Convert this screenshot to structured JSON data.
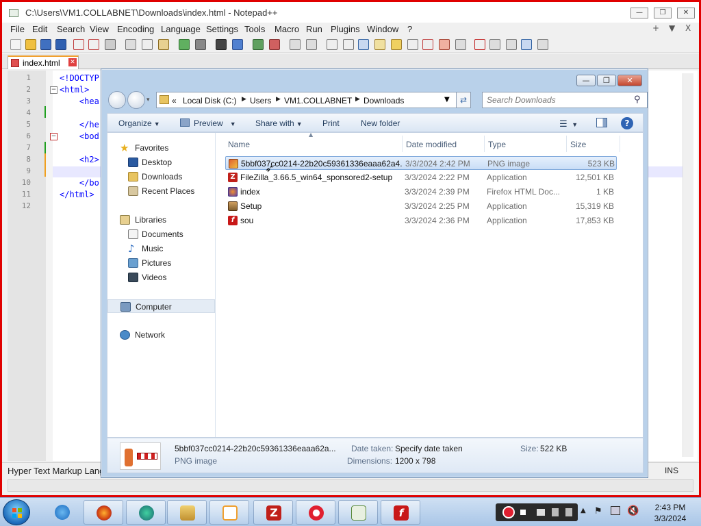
{
  "npp": {
    "title": "C:\\Users\\VM1.COLLABNET\\Downloads\\index.html - Notepad++",
    "menu": [
      "File",
      "Edit",
      "Search",
      "View",
      "Encoding",
      "Language",
      "Settings",
      "Tools",
      "Macro",
      "Run",
      "Plugins",
      "Window",
      "?"
    ],
    "menu_right": [
      "+",
      "▼",
      "X"
    ],
    "tab_label": "index.html",
    "line_numbers": [
      "1",
      "2",
      "3",
      "4",
      "5",
      "6",
      "7",
      "8",
      "9",
      "10",
      "11",
      "12"
    ],
    "code_lines": [
      "<!DOCTYP",
      "<html>",
      "    <hea",
      "",
      "    </he",
      "    <bod",
      "",
      "    <h2>",
      "",
      "    </bo",
      "</html>",
      ""
    ],
    "status_left": "Hyper Text Markup Langu",
    "status_right": "INS"
  },
  "dialog": {
    "address": [
      "«",
      "Local Disk (C:)",
      "Users",
      "VM1.COLLABNET",
      "Downloads"
    ],
    "search_placeholder": "Search Downloads",
    "commands": {
      "organize": "Organize",
      "preview": "Preview",
      "share": "Share with",
      "print": "Print",
      "new_folder": "New folder"
    },
    "nav": {
      "favorites": "Favorites",
      "desktop": "Desktop",
      "downloads": "Downloads",
      "recent": "Recent Places",
      "libraries": "Libraries",
      "documents": "Documents",
      "music": "Music",
      "pictures": "Pictures",
      "videos": "Videos",
      "computer": "Computer",
      "network": "Network"
    },
    "columns": {
      "name": "Name",
      "date": "Date modified",
      "type": "Type",
      "size": "Size"
    },
    "files": [
      {
        "name": "5bbf037cc0214-22b20c59361336eaaa62a4...",
        "date": "3/3/2024 2:42 PM",
        "type": "PNG image",
        "size": "523 KB"
      },
      {
        "name": "FileZilla_3.66.5_win64_sponsored2-setup",
        "date": "3/3/2024 2:22 PM",
        "type": "Application",
        "size": "12,501 KB"
      },
      {
        "name": "index",
        "date": "3/3/2024 2:39 PM",
        "type": "Firefox HTML Doc...",
        "size": "1 KB"
      },
      {
        "name": "Setup",
        "date": "3/3/2024 2:25 PM",
        "type": "Application",
        "size": "15,319 KB"
      },
      {
        "name": "sou",
        "date": "3/3/2024 2:36 PM",
        "type": "Application",
        "size": "17,853 KB"
      }
    ],
    "details": {
      "filename": "5bbf037cc0214-22b20c59361336eaaa62a...",
      "filetype": "PNG image",
      "date_taken_label": "Date taken:",
      "date_taken_value": "Specify date taken",
      "dimensions_label": "Dimensions:",
      "dimensions_value": "1200 x 798",
      "size_label": "Size:",
      "size_value": "522 KB"
    }
  },
  "clock": {
    "time": "2:43 PM",
    "date": "3/3/2024"
  },
  "colors": {
    "npp_border": "#e00000",
    "selection": "#c9ddf6",
    "accent": "#1e395b"
  }
}
